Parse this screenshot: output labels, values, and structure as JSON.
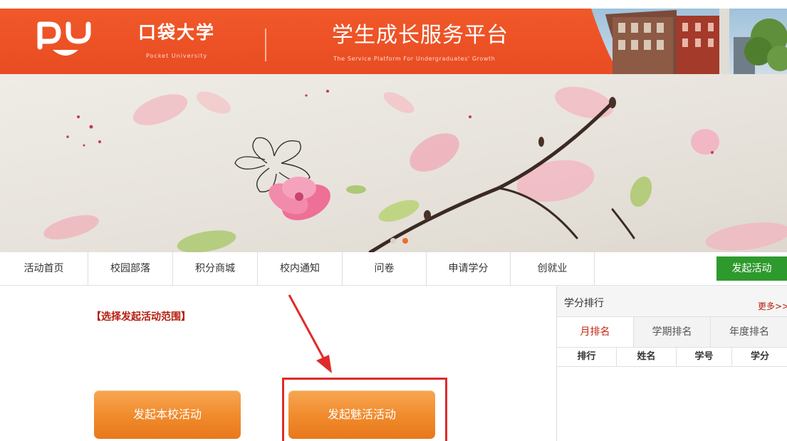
{
  "header": {
    "logo_mark": "PU",
    "logo_cn": "口袋大学",
    "logo_en": "Pocket University",
    "platform_title": "学生成长服务平台",
    "platform_subtitle": "The Service Platform For Undergraduates' Growth"
  },
  "banner": {
    "slides": 2,
    "active_slide": 2
  },
  "nav": {
    "items": [
      {
        "label": "活动首页"
      },
      {
        "label": "校园部落"
      },
      {
        "label": "积分商城"
      },
      {
        "label": "校内通知"
      },
      {
        "label": "问卷"
      },
      {
        "label": "申请学分"
      },
      {
        "label": "创就业"
      }
    ],
    "launch_button": "发起活动"
  },
  "main": {
    "scope_title": "【选择发起活动范围】",
    "buttons": {
      "local": "发起本校活动",
      "charm": "发起魅活活动"
    }
  },
  "ranking": {
    "title": "学分排行",
    "more": "更多>>",
    "tabs": [
      {
        "label": "月排名",
        "active": true
      },
      {
        "label": "学期排名",
        "active": false
      },
      {
        "label": "年度排名",
        "active": false
      }
    ],
    "columns": [
      "排行",
      "姓名",
      "学号",
      "学分"
    ]
  },
  "colors": {
    "brand_orange": "#e94c22",
    "launch_green": "#2e9a2e",
    "button_orange": "#f08a2b",
    "highlight_red": "#e12a2a",
    "title_red": "#b51c0c"
  }
}
